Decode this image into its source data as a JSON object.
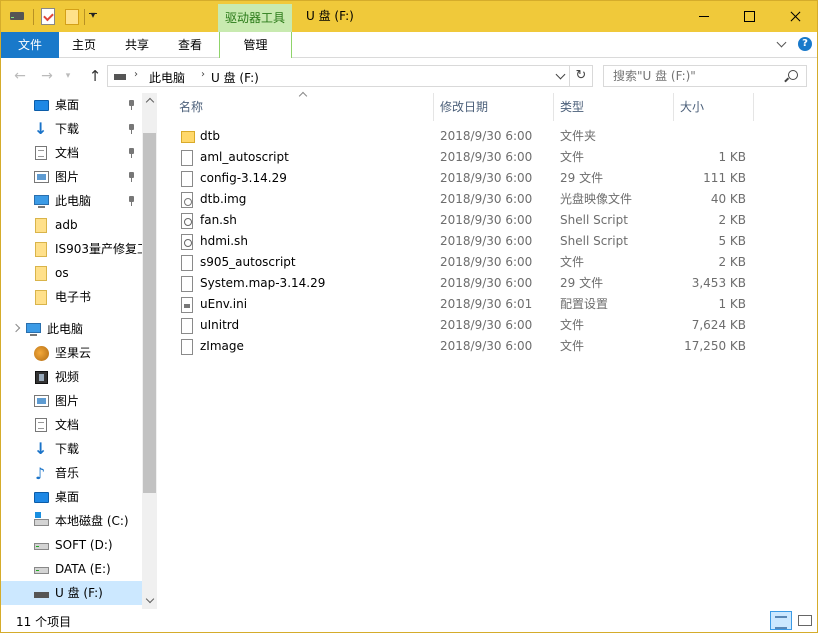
{
  "titlebar": {
    "context_tab": "驱动器工具",
    "title": "U 盘 (F:)"
  },
  "ribbon": {
    "file": "文件",
    "home": "主页",
    "share": "共享",
    "view": "查看",
    "manage": "管理",
    "help": "?"
  },
  "address": {
    "crumbs": [
      "此电脑",
      "U 盘 (F:)"
    ],
    "search_placeholder": "搜索\"U 盘 (F:)\""
  },
  "nav": {
    "quick_access": [
      {
        "label": "桌面",
        "icon": "desktop-icon"
      },
      {
        "label": "下载",
        "icon": "download-icon"
      },
      {
        "label": "文档",
        "icon": "documents-icon"
      },
      {
        "label": "图片",
        "icon": "pictures-icon"
      },
      {
        "label": "此电脑",
        "icon": "this-pc-icon"
      },
      {
        "label": "adb",
        "icon": "folder-icon"
      },
      {
        "label": "IS903量产修复工",
        "icon": "folder-icon"
      },
      {
        "label": "os",
        "icon": "folder-icon"
      },
      {
        "label": "电子书",
        "icon": "folder-icon"
      }
    ],
    "this_pc": {
      "label": "此电脑",
      "icon": "this-pc-icon"
    },
    "pc_items": [
      {
        "label": "坚果云",
        "icon": "nutstore-icon"
      },
      {
        "label": "视频",
        "icon": "videos-icon"
      },
      {
        "label": "图片",
        "icon": "pictures-icon"
      },
      {
        "label": "文档",
        "icon": "documents-icon"
      },
      {
        "label": "下载",
        "icon": "download-icon"
      },
      {
        "label": "音乐",
        "icon": "music-icon"
      },
      {
        "label": "桌面",
        "icon": "desktop-icon"
      },
      {
        "label": "本地磁盘 (C:)",
        "icon": "system-drive-icon"
      },
      {
        "label": "SOFT (D:)",
        "icon": "drive-icon"
      },
      {
        "label": "DATA (E:)",
        "icon": "drive-icon"
      },
      {
        "label": "U 盘 (F:)",
        "icon": "usb-drive-icon",
        "selected": true
      }
    ]
  },
  "columns": {
    "name": "名称",
    "date": "修改日期",
    "type": "类型",
    "size": "大小"
  },
  "files": [
    {
      "name": "dtb",
      "date": "2018/9/30 6:00",
      "type": "文件夹",
      "size": "",
      "icon": "folder-icon"
    },
    {
      "name": "aml_autoscript",
      "date": "2018/9/30 6:00",
      "type": "文件",
      "size": "1 KB",
      "icon": "file-icon"
    },
    {
      "name": "config-3.14.29",
      "date": "2018/9/30 6:00",
      "type": "29 文件",
      "size": "111 KB",
      "icon": "file-icon"
    },
    {
      "name": "dtb.img",
      "date": "2018/9/30 6:00",
      "type": "光盘映像文件",
      "size": "40 KB",
      "icon": "disc-image-icon"
    },
    {
      "name": "fan.sh",
      "date": "2018/9/30 6:00",
      "type": "Shell Script",
      "size": "2 KB",
      "icon": "shell-script-icon"
    },
    {
      "name": "hdmi.sh",
      "date": "2018/9/30 6:00",
      "type": "Shell Script",
      "size": "5 KB",
      "icon": "shell-script-icon"
    },
    {
      "name": "s905_autoscript",
      "date": "2018/9/30 6:00",
      "type": "文件",
      "size": "2 KB",
      "icon": "file-icon"
    },
    {
      "name": "System.map-3.14.29",
      "date": "2018/9/30 6:00",
      "type": "29 文件",
      "size": "3,453 KB",
      "icon": "file-icon"
    },
    {
      "name": "uEnv.ini",
      "date": "2018/9/30 6:01",
      "type": "配置设置",
      "size": "1 KB",
      "icon": "config-file-icon"
    },
    {
      "name": "uInitrd",
      "date": "2018/9/30 6:00",
      "type": "文件",
      "size": "7,624 KB",
      "icon": "file-icon"
    },
    {
      "name": "zImage",
      "date": "2018/9/30 6:00",
      "type": "文件",
      "size": "17,250 KB",
      "icon": "file-icon"
    }
  ],
  "status": {
    "count": "11 个项目"
  }
}
